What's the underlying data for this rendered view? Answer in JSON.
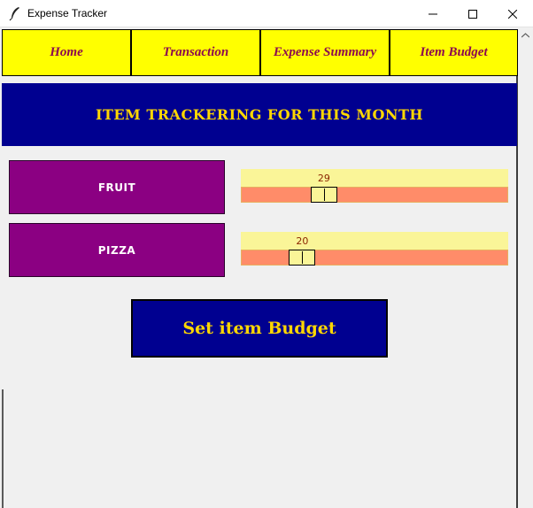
{
  "window": {
    "title": "Expense Tracker",
    "icon": "feather-icon"
  },
  "nav": {
    "home": "Home",
    "transaction": "Transaction",
    "expense_summary": "Expense Summary",
    "item_budget": "Item Budget"
  },
  "banner": {
    "title": "ITEM TRACKERING FOR THIS MONTH"
  },
  "items": [
    {
      "label": "FRUIT",
      "value": "29",
      "fraction": 0.29
    },
    {
      "label": "PIZZA",
      "value": "20",
      "fraction": 0.2
    }
  ],
  "set_button": "Set item Budget",
  "colors": {
    "nav_bg": "#ffff00",
    "nav_text": "#8b0a50",
    "banner_bg": "#000090",
    "banner_text": "#ffd700",
    "item_bg": "#8b0082",
    "slider_trough": "#ff8c69",
    "slider_value_bg": "#faf598"
  }
}
